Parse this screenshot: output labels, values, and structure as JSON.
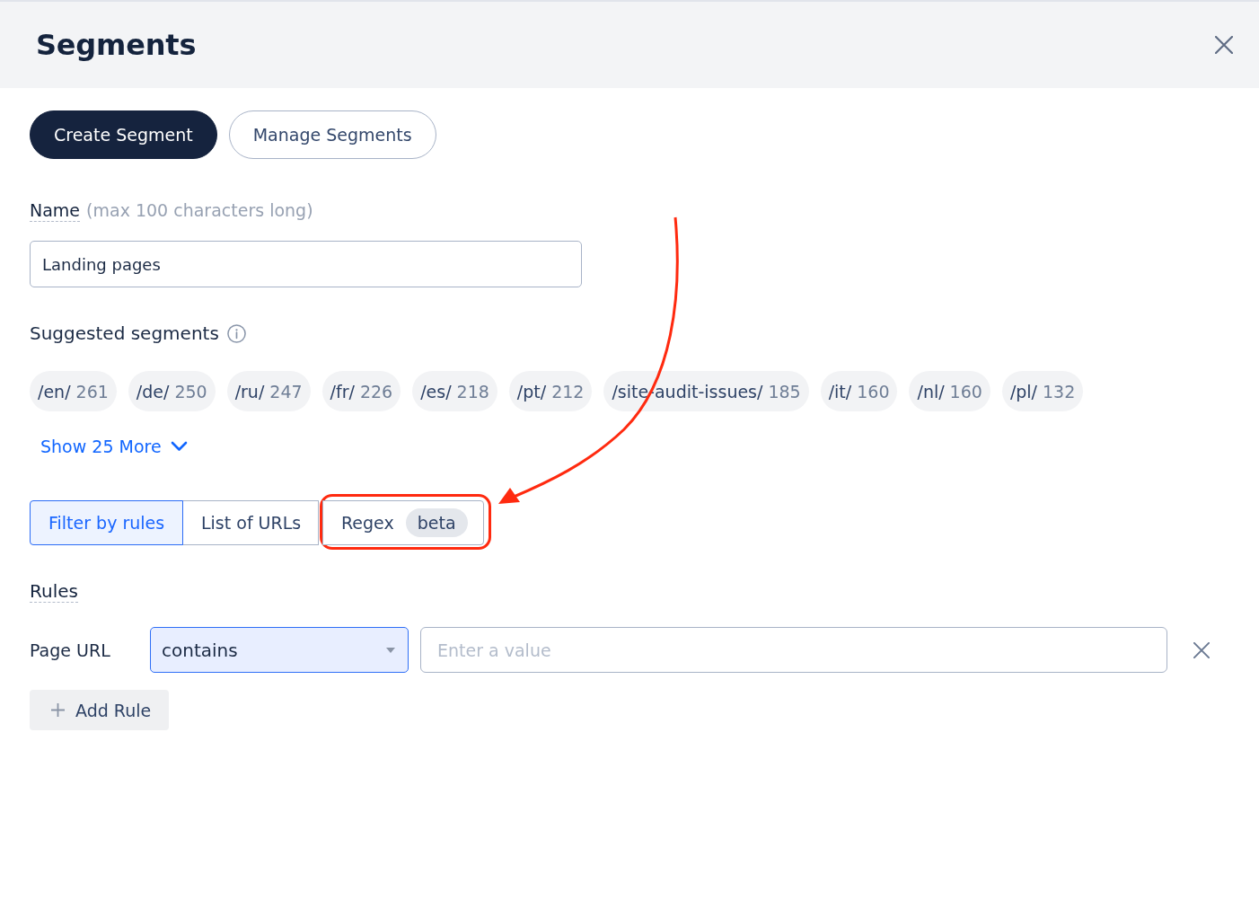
{
  "header": {
    "title": "Segments"
  },
  "mode_buttons": [
    {
      "label": "Create Segment",
      "selected": true
    },
    {
      "label": "Manage Segments",
      "selected": false
    }
  ],
  "name_field": {
    "label": "Name",
    "hint": "(max 100 characters long)",
    "value": "Landing pages"
  },
  "suggested": {
    "title": "Suggested segments",
    "chips": [
      {
        "path": "/en/",
        "count": "261"
      },
      {
        "path": "/de/",
        "count": "250"
      },
      {
        "path": "/ru/",
        "count": "247"
      },
      {
        "path": "/fr/",
        "count": "226"
      },
      {
        "path": "/es/",
        "count": "218"
      },
      {
        "path": "/pt/",
        "count": "212"
      },
      {
        "path": "/site-audit-issues/",
        "count": "185"
      },
      {
        "path": "/it/",
        "count": "160"
      },
      {
        "path": "/nl/",
        "count": "160"
      },
      {
        "path": "/pl/",
        "count": "132"
      }
    ],
    "show_more": "Show 25 More"
  },
  "filter_tabs": [
    {
      "label": "Filter by rules",
      "selected": true,
      "highlighted": false
    },
    {
      "label": "List of URLs",
      "selected": false,
      "highlighted": false
    },
    {
      "label": "Regex",
      "badge": "beta",
      "selected": false,
      "highlighted": true
    }
  ],
  "rules": {
    "title": "Rules",
    "items": [
      {
        "field": "Page URL",
        "operator": "contains",
        "placeholder": "Enter a value"
      }
    ],
    "add_button": "Add Rule"
  }
}
